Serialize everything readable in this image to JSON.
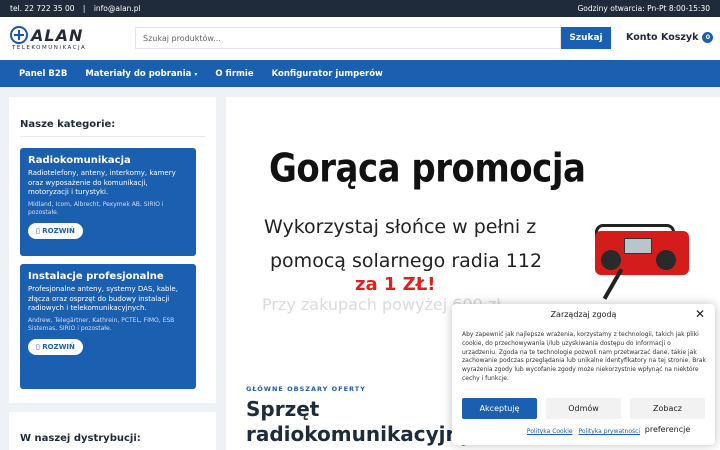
{
  "topbar": {
    "phone": "tel. 22 722 35 00",
    "separator": "|",
    "email": "info@alan.pl",
    "hours": "Godziny otwarcia: Pn-Pt 8:00-15:30"
  },
  "logo": {
    "name": "ALAN",
    "subtitle": "TELEKOMUNIKACJA"
  },
  "search": {
    "placeholder": "Szukaj produktów...",
    "button": "Szukaj"
  },
  "header": {
    "account": "Konto",
    "cart": "Koszyk",
    "cart_count": "0"
  },
  "nav": {
    "items": [
      {
        "label": "Panel B2B"
      },
      {
        "label": "Materiały do pobrania",
        "caret": "▾"
      },
      {
        "label": "O firmie"
      },
      {
        "label": "Konfigurator jumperów"
      }
    ]
  },
  "sidebar": {
    "title": "Nasze kategorie:",
    "categories": [
      {
        "title": "Radiokomunikacja",
        "desc": "Radiotelefony, anteny, interkomy, kamery oraz wyposażenie do komunikacji, motoryzacji i turystyki.",
        "brands": "Midland, Icom, Albrecht, Pexymek AB, SIRIO i pozostałe.",
        "expand": "ROZWIŃ"
      },
      {
        "title": "Instalacje profesjonalne",
        "desc": "Profesjonalne anteny, systemy DAS, kable, złącza oraz osprzęt do budowy instalacji radiowych i telekomunikacyjnych.",
        "brands": "Andrew, Telegärtner, Kathrein, PCTEL, FIMO, ESB Sistemas, SIRIO i pozostałe.",
        "expand": "ROZWIŃ"
      }
    ],
    "distribution_title": "W naszej dystrybucji:"
  },
  "banner": {
    "title": "Gorąca promocja",
    "line1": "Wykorzystaj słońce w pełni z",
    "line2": "pomocą solarnego radia 112",
    "price": "za 1 ZŁ!",
    "faded": "Przy zakupach powyżej 600 zł"
  },
  "offer": {
    "kicker": "GŁÓWNE OBSZARY OFERTY",
    "title": "Sprzęt radiokomunikacyjny i antenowy"
  },
  "consent": {
    "title": "Zarządzaj zgodą",
    "text": "Aby zapewnić jak najlepsze wrażenia, korzystamy z technologii, takich jak pliki cookie, do przechowywania i/lub uzyskiwania dostępu do informacji o urządzeniu. Zgoda na te technologie pozwoli nam przetwarzać dane, takie jak zachowanie podczas przeglądania lub unikalne identyfikatory na tej stronie. Brak wyrażenia zgody lub wycofanie zgody może niekorzystnie wpłynąć na niektóre cechy i funkcje.",
    "accept": "Akceptuję",
    "deny": "Odmów",
    "prefs": "Zobacz preferencje",
    "cookie_policy": "Polityka Cookie",
    "privacy_policy": "Polityka prywatności"
  }
}
